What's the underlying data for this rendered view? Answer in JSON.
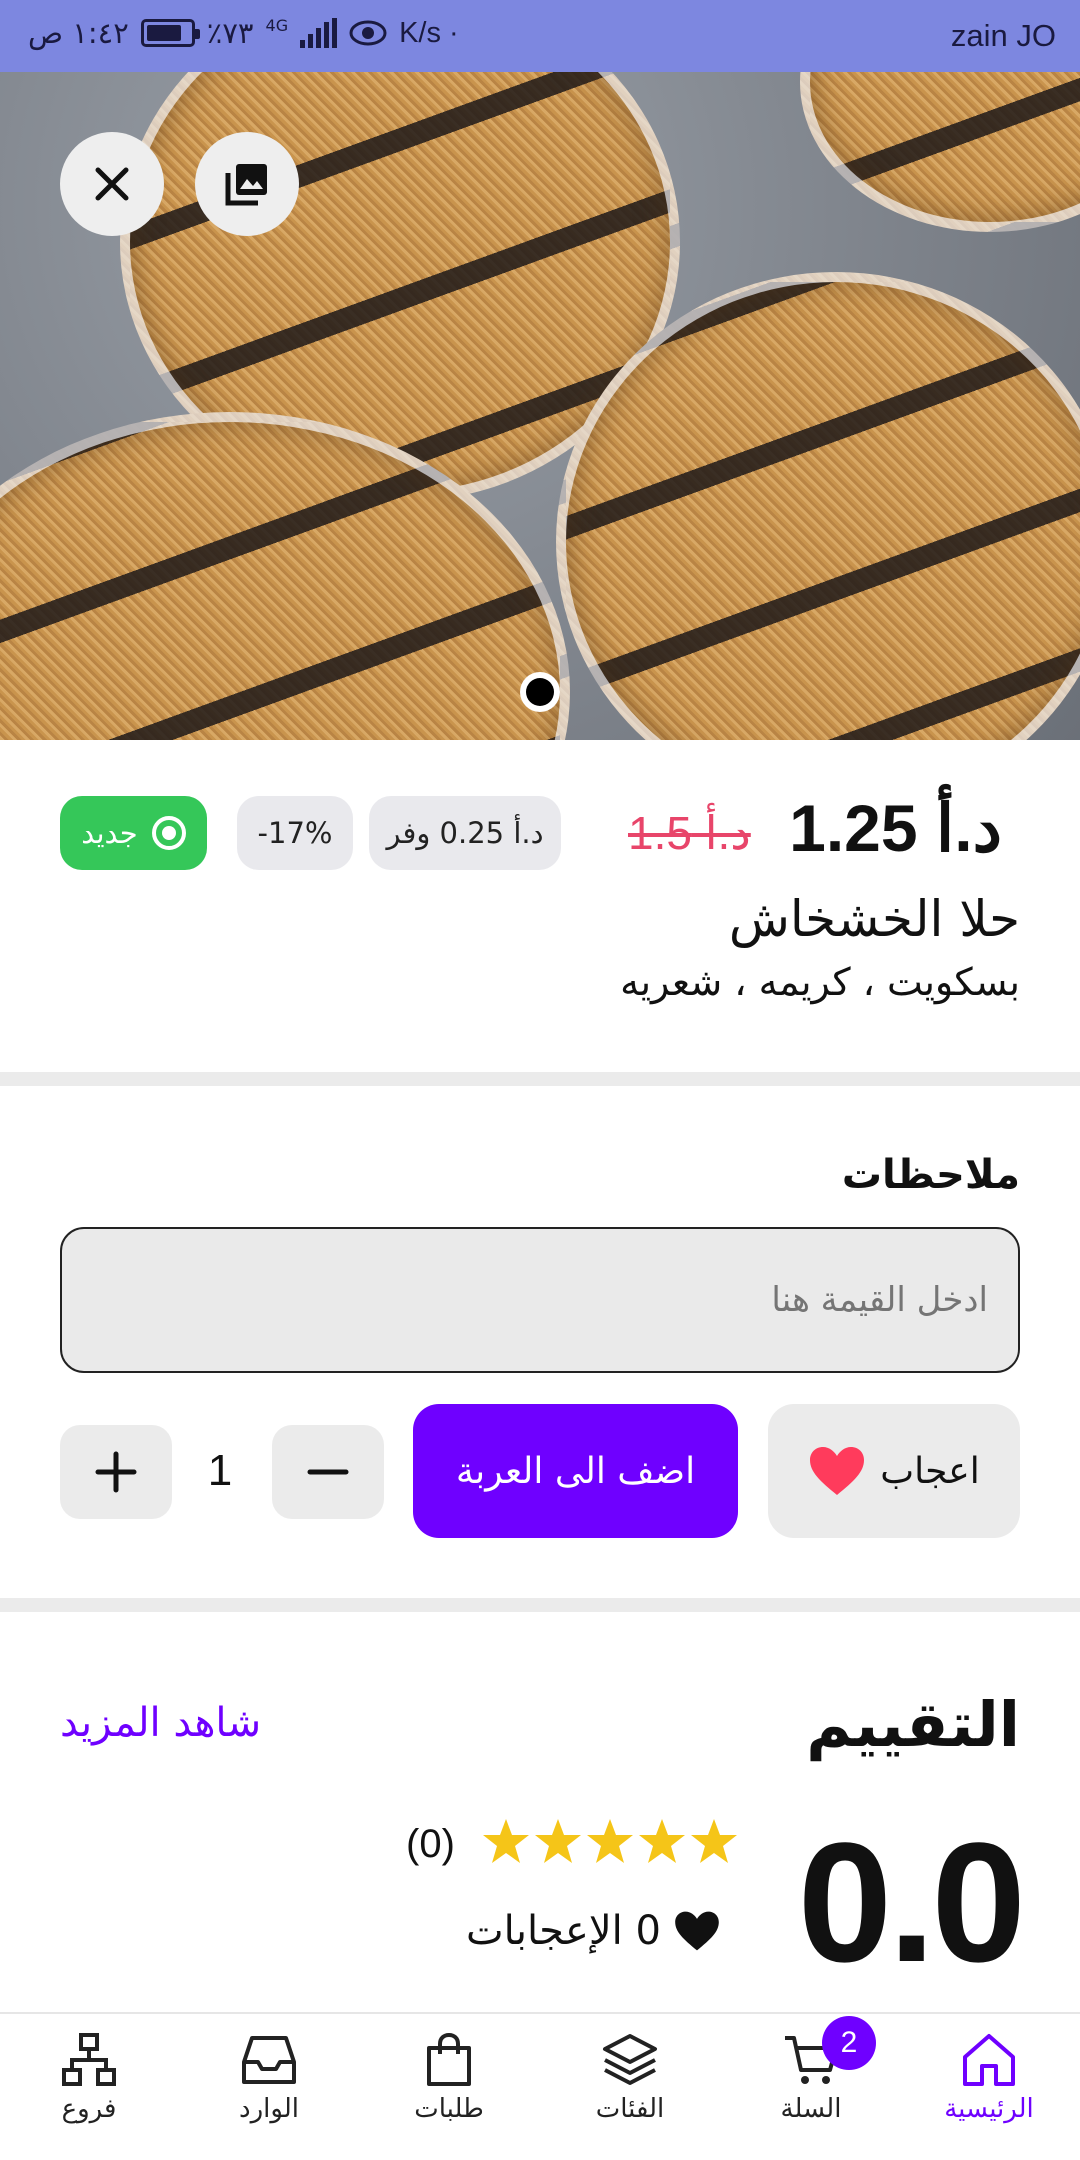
{
  "status_bar": {
    "carrier": "zain JO",
    "net_speed": "K/s ·",
    "battery": "٪٧٣",
    "network": "4G",
    "time": "١:٤٢ ص"
  },
  "hero": {
    "close_icon": "close-icon",
    "gallery_icon": "gallery-icon",
    "page_dots": 1
  },
  "product": {
    "price": "د.أ 1.25",
    "old_price": "د.أ 1.5",
    "save_label": "د.أ 0.25 وفر",
    "discount_label": "-17%",
    "new_label": "جديد",
    "title": "حلا الخشخاش",
    "subtitle": "بسكويت ، كريمه ، شعريه",
    "colors": {
      "old_price": "#e8456a",
      "new_badge": "#35c759"
    }
  },
  "notes": {
    "label": "ملاحظات",
    "placeholder": "ادخل القيمة هنا"
  },
  "actions": {
    "like_label": "اعجاب",
    "add_to_cart_label": "اضف الى العربة",
    "quantity": "1",
    "accent": "#6f00ff",
    "heart_color": "#ff3b5c"
  },
  "rating": {
    "title": "التقييم",
    "see_more": "شاهد المزيد",
    "score": "0.0",
    "stars": 5,
    "count": "(0)",
    "likes_label": "0 الإعجابات",
    "star_color": "#f5c518"
  },
  "nav": {
    "items": [
      {
        "label": "الرئيسية",
        "icon": "home-icon",
        "active": true
      },
      {
        "label": "السلة",
        "icon": "cart-icon",
        "badge": "2"
      },
      {
        "label": "الفئات",
        "icon": "layers-icon"
      },
      {
        "label": "طلبات",
        "icon": "shopping-bag-icon"
      },
      {
        "label": "الوارد",
        "icon": "inbox-icon"
      },
      {
        "label": "فروع",
        "icon": "branches-icon"
      }
    ]
  }
}
